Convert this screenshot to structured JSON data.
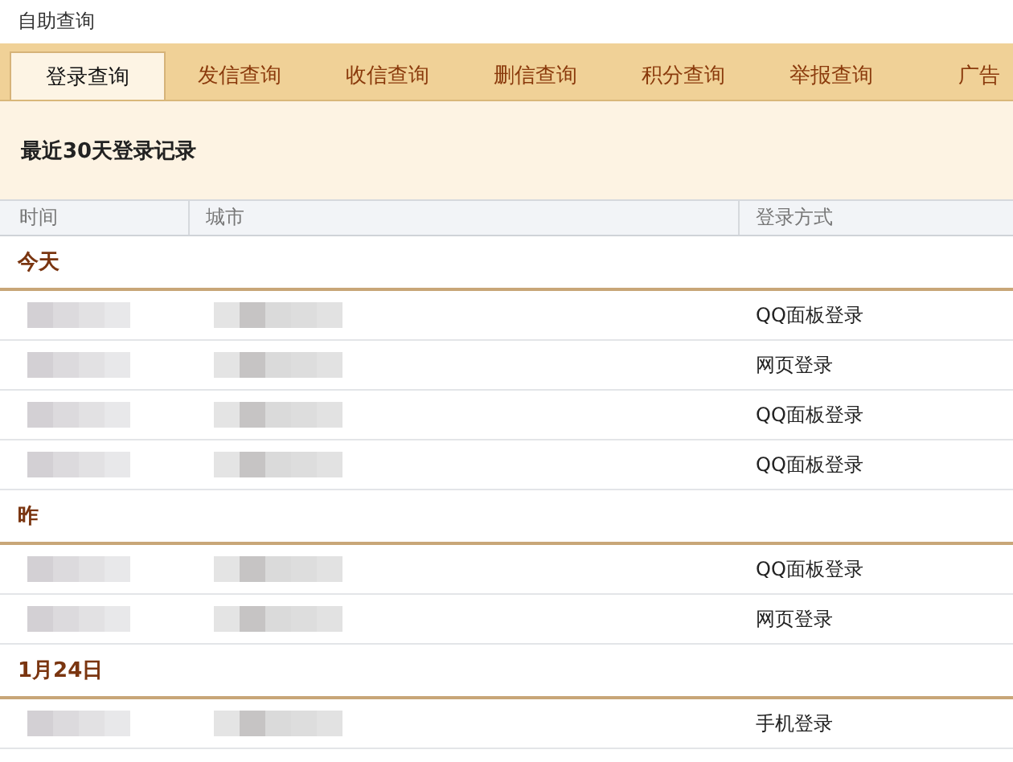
{
  "title": "自助查询",
  "tabs": [
    {
      "label": "登录查询",
      "selected": true
    },
    {
      "label": "发信查询",
      "selected": false
    },
    {
      "label": "收信查询",
      "selected": false
    },
    {
      "label": "删信查询",
      "selected": false
    },
    {
      "label": "积分查询",
      "selected": false
    },
    {
      "label": "举报查询",
      "selected": false
    },
    {
      "label": "广告",
      "selected": false
    }
  ],
  "section_title": "最近30天登录记录",
  "table": {
    "columns": [
      "时间",
      "城市",
      "登录方式"
    ],
    "groups": [
      {
        "label": "今天",
        "rows": [
          {
            "redacted": true,
            "method": "QQ面板登录"
          },
          {
            "redacted": true,
            "method": "网页登录"
          },
          {
            "redacted": true,
            "method": "QQ面板登录"
          },
          {
            "redacted": true,
            "method": "QQ面板登录"
          }
        ]
      },
      {
        "label": "昨",
        "rows": [
          {
            "redacted": true,
            "method": "QQ面板登录"
          },
          {
            "redacted": true,
            "method": "网页登录"
          }
        ]
      },
      {
        "label": "1月24日",
        "rows": [
          {
            "redacted": true,
            "method": "手机登录"
          }
        ]
      }
    ]
  }
}
